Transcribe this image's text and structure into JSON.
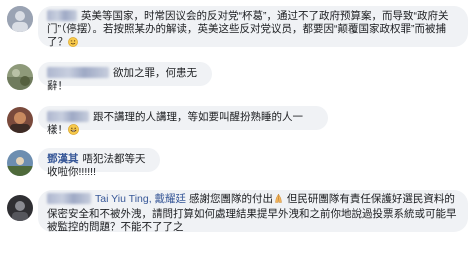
{
  "comments": [
    {
      "text": "英美等国家，时常因议会的反对党“杯葛”，通过不了政府预算案，而导致“政府关门”（停摆）。若按照某办的解读，英美这些反对党议员，都要因“颠覆国家政权罪”而被捕了？",
      "emoji": "wink"
    },
    {
      "text": "欲加之罪，何患无辭！"
    },
    {
      "text": "跟不講理的人講理，等如要叫醒扮熟睡的人一樣！",
      "emoji": "grin"
    },
    {
      "name": "鄧漢其",
      "text": "唔犯法都等天收啦你!!!!!!"
    },
    {
      "mention": "Tai Yiu Ting, 戴耀廷",
      "text_before_emoji": "感謝您團隊的付出",
      "text_after_emoji": "但民研團隊有責任保護好選民資料的保密安全和不被外洩，請問打算如何處理結果提早外洩和之前你地說過投票系統或可能早被監控的問題？不能不了了之",
      "emoji": "praying-hands"
    }
  ]
}
